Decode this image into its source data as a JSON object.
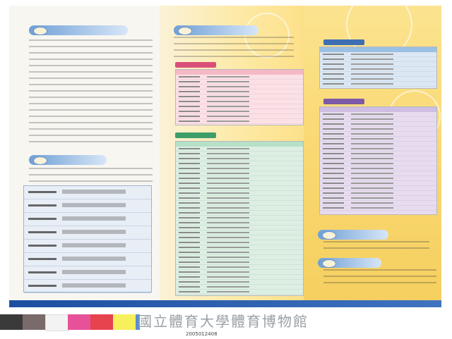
{
  "footer": {
    "museum_name": "國立體育大學體育博物館",
    "catalog_id": "2005012408"
  },
  "colors": {
    "band": "#1c4fa0",
    "panel_yellow": "#f9d76f",
    "table_green": "#b6e0c7",
    "table_pink": "#f5b9c6",
    "table_purple": "#cfbde2"
  }
}
